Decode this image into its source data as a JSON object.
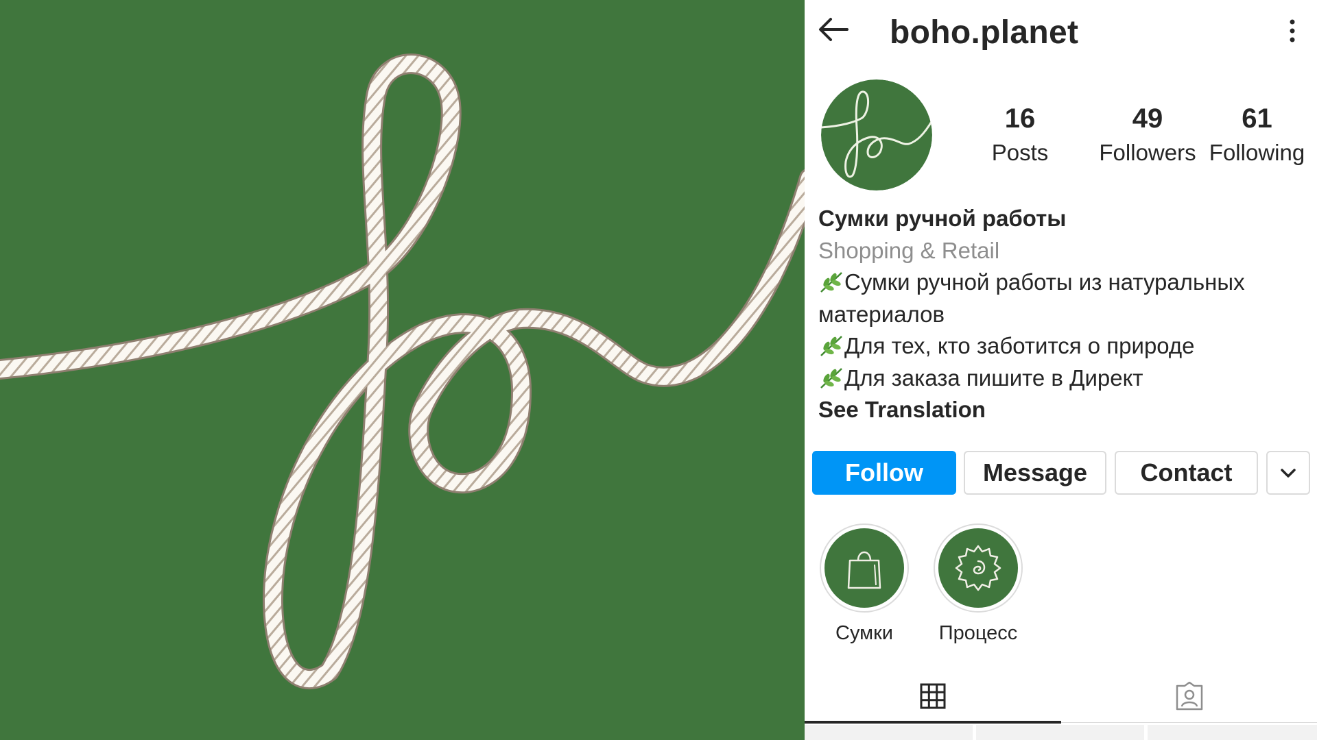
{
  "colors": {
    "brand_green": "#40763d",
    "follow_blue": "#0095f6",
    "text_primary": "#262626",
    "text_secondary": "#8e8e8e",
    "border": "#dbdbdb"
  },
  "header": {
    "username": "boho.planet",
    "back_icon": "arrow-left-icon",
    "more_icon": "vertical-dots-icon"
  },
  "stats": {
    "posts": {
      "count": "16",
      "label": "Posts"
    },
    "followers": {
      "count": "49",
      "label": "Followers"
    },
    "following": {
      "count": "61",
      "label": "Following"
    }
  },
  "bio": {
    "name": "Сумки ручной работы",
    "category": "Shopping & Retail",
    "lines": [
      "Сумки ручной работы из натуральных материалов",
      "Для тех, кто заботится о природе",
      "Для заказа пишите в Директ"
    ],
    "leaf_icon": "herb-leaf-icon",
    "see_translation": "See Translation"
  },
  "actions": {
    "follow": "Follow",
    "message": "Message",
    "contact": "Contact",
    "more_icon": "chevron-down-icon"
  },
  "highlights": [
    {
      "label": "Сумки",
      "icon": "shopping-bag-icon"
    },
    {
      "label": "Процесс",
      "icon": "gear-icon"
    }
  ],
  "tabs": [
    {
      "icon": "grid-icon",
      "active": true
    },
    {
      "icon": "tagged-user-icon",
      "active": false
    }
  ]
}
